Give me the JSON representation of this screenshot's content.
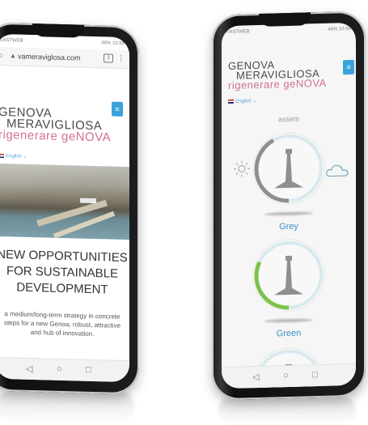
{
  "left_phone": {
    "status_left": "FASTWEB",
    "status_right": "46% 10:55",
    "url": "vameraviglosa.com",
    "tabs_count": "1",
    "logo_line1": "GENOVA",
    "logo_line2": "MERAVIGLIOSA",
    "logo_tagline": "rigenerare geNOVA",
    "language": "English",
    "headline_1": "NEW OPPORTUNITIES",
    "headline_2": "FOR SUSTAINABLE",
    "headline_3": "DEVELOPMENT",
    "subtext": "a medium/long-term strategy in concrete steps for a new Genoa, robust, attractive and hub of innovation.",
    "nav_back": "◁",
    "nav_home": "○",
    "nav_recent": "□"
  },
  "right_phone": {
    "status_left": "FASTWEB",
    "status_right": "46% 10:54",
    "logo_line1": "GENOVA",
    "logo_line2": "MERAVIGLIOSA",
    "logo_tagline": "rigenerare geNOVA",
    "language": "English",
    "section_title": "assets",
    "gauges": [
      {
        "label": "Grey",
        "color": "#8f8f8f",
        "fraction": 0.42
      },
      {
        "label": "Green",
        "color": "#7cc24a",
        "fraction": 0.32
      }
    ],
    "nav_back": "◁",
    "nav_home": "○",
    "nav_recent": "□"
  },
  "colors": {
    "accent": "#3aa3dc",
    "tagline": "#d2728b",
    "gauge_track": "#d7e9ee"
  }
}
